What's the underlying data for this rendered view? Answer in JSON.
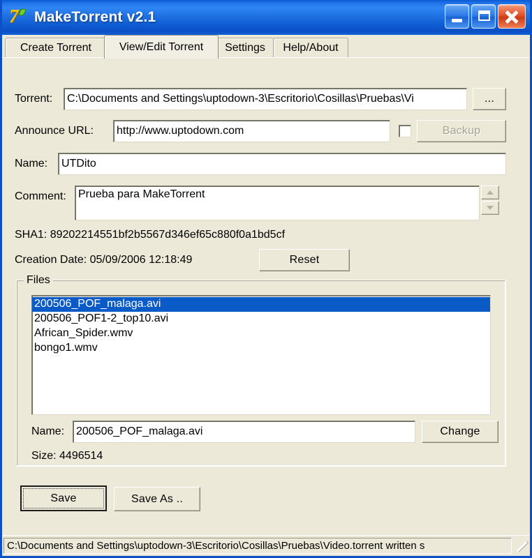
{
  "window": {
    "title": "MakeTorrent v2.1",
    "icon": "app-torrent-icon",
    "minimize_label": "Minimize",
    "maximize_label": "Maximize",
    "close_label": "Close",
    "accent_titlebar": "#1e72e8",
    "client_bg": "#ece9d8",
    "selection_color": "#0a5ac8"
  },
  "tabs": [
    {
      "label": "Create Torrent",
      "active": false
    },
    {
      "label": "View/Edit Torrent",
      "active": true
    },
    {
      "label": "Settings",
      "active": false
    },
    {
      "label": "Help/About",
      "active": false
    }
  ],
  "form": {
    "torrent_label": "Torrent:",
    "torrent_value": "C:\\Documents and Settings\\uptodown-3\\Escritorio\\Cosillas\\Pruebas\\Vi",
    "browse_button": "...",
    "announce_label": "Announce URL:",
    "announce_value": "http://www.uptodown.com",
    "backup_checkbox_checked": false,
    "backup_button": "Backup",
    "backup_button_enabled": false,
    "name_label": "Name:",
    "name_value": "UTDito",
    "comment_label": "Comment:",
    "comment_value": "Prueba para MakeTorrent",
    "scroll_up_icon": "arrow-up-icon",
    "scroll_down_icon": "arrow-down-icon",
    "sha1_text": "SHA1: 89202214551bf2b5567d346ef65c880f0a1bd5cf",
    "creation_date_text": "Creation Date: 05/09/2006 12:18:49",
    "reset_button": "Reset"
  },
  "files_group": {
    "title": "Files",
    "items": [
      {
        "name": "200506_POF_malaga.avi",
        "selected": true
      },
      {
        "name": "200506_POF1-2_top10.avi",
        "selected": false
      },
      {
        "name": "African_Spider.wmv",
        "selected": false
      },
      {
        "name": "bongo1.wmv",
        "selected": false
      }
    ],
    "name_label": "Name:",
    "name_value": "200506_POF_malaga.avi",
    "change_button": "Change",
    "size_text": "Size: 4496514"
  },
  "actions": {
    "save_button": "Save",
    "save_as_button": "Save As ..",
    "save_is_default": true
  },
  "statusbar": {
    "text": "C:\\Documents and Settings\\uptodown-3\\Escritorio\\Cosillas\\Pruebas\\Video.torrent written s",
    "grip_icon": "resize-grip-icon"
  }
}
